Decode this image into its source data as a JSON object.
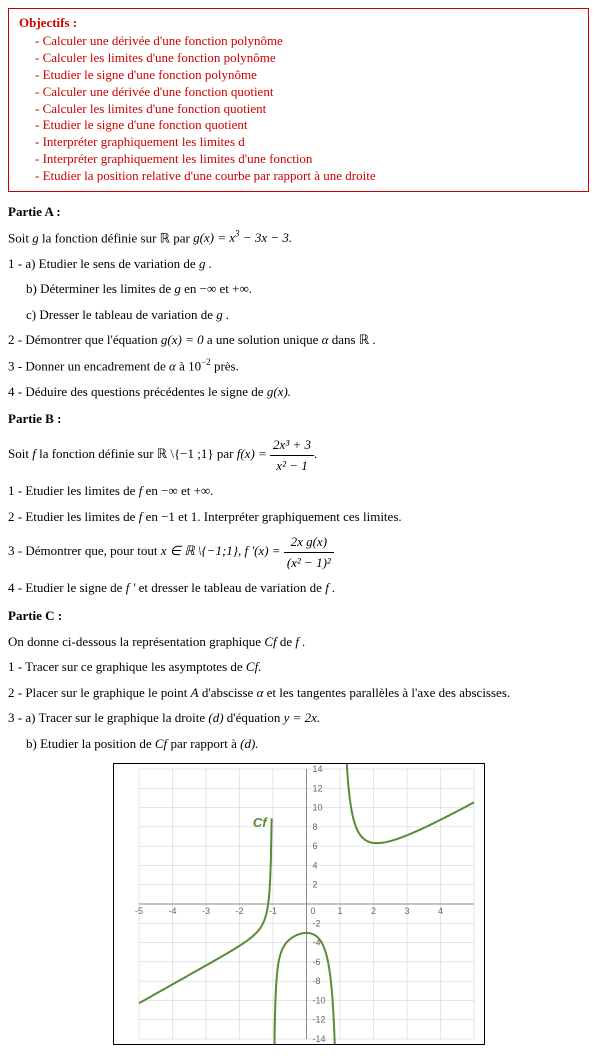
{
  "objectifs": {
    "title": "Objectifs :",
    "items": [
      "Calculer une dérivée d'une fonction polynôme",
      "Calculer les limites d'une fonction polynôme",
      "Etudier le signe d'une fonction polynôme",
      "Calculer une dérivée d'une fonction quotient",
      "Calculer les limites d'une fonction quotient",
      "Etudier le signe d'une fonction quotient",
      "Interpréter graphiquement les limites d",
      "Interpréter graphiquement les limites d'une fonction",
      "Etudier la position relative d'une courbe par rapport à une droite"
    ]
  },
  "partieA": {
    "title": "Partie A :",
    "intro_pre": "Soit ",
    "intro_g": "g",
    "intro_mid": " la fonction définie sur ",
    "intro_R": "ℝ",
    "intro_par": " par ",
    "intro_gx": "g(x) = x",
    "intro_exp": "3",
    "intro_rest": " − 3x − 3.",
    "q1a": "1 - a) Etudier le sens de variation de ",
    "q1a_g": "g .",
    "q1b": "b) Déterminer les limites de ",
    "q1b_g": "g",
    "q1b_en": " en −∞ et +∞.",
    "q1c": "c) Dresser le tableau de variation de ",
    "q1c_g": "g .",
    "q2": "2 - Démontrer que l'équation ",
    "q2_eq": "g(x) = 0",
    "q2_rest": " a une solution unique ",
    "q2_alpha": "α",
    "q2_dans": " dans ",
    "q2_R": "ℝ .",
    "q3": "3 - Donner un encadrement de ",
    "q3_alpha": "α",
    "q3_a": " à 10",
    "q3_exp": "−2",
    "q3_pres": " près.",
    "q4": "4 - Déduire des questions précédentes le signe de ",
    "q4_gx": "g(x)."
  },
  "partieB": {
    "title": "Partie B :",
    "intro_pre": "Soit ",
    "intro_f": "f",
    "intro_mid": " la fonction définie sur ",
    "intro_R": "ℝ \\{−1 ;1}",
    "intro_par": " par ",
    "intro_fx": "f(x) = ",
    "frac_num": "2x³ + 3",
    "frac_den": "x² − 1",
    "period": ".",
    "q1": "1 - Etudier les limites de ",
    "q1_f": "f",
    "q1_en": " en −∞ et +∞.",
    "q2": "2 - Etudier les limites de ",
    "q2_f": "f",
    "q2_en": " en −1 et 1. Interpréter graphiquement ces limites.",
    "q3": "3 - Démontrer que, pour tout ",
    "q3_x": "x ∈ ℝ \\{−1;1}, f '(x) = ",
    "q3_num": "2x g(x)",
    "q3_den": "(x² − 1)²",
    "q4": "4 - Etudier le signe de ",
    "q4_fp": "f '",
    "q4_rest": " et dresser le tableau de variation de ",
    "q4_f": "f ."
  },
  "partieC": {
    "title": "Partie C :",
    "intro": "On donne ci-dessous la représentation graphique ",
    "intro_cf": "Cf",
    "intro_de": " de ",
    "intro_f": "f .",
    "q1": "1 - Tracer sur ce graphique les asymptotes de ",
    "q1_cf": "Cf.",
    "q2": "2 - Placer sur le graphique le point ",
    "q2_A": "A",
    "q2_ab": " d'abscisse ",
    "q2_alpha": "α",
    "q2_rest": " et les tangentes parallèles à l'axe des abscisses.",
    "q3a": "3 - a) Tracer sur le graphique la droite ",
    "q3a_d": "(d)",
    "q3a_eq": " d'équation ",
    "q3a_y": "y = 2x.",
    "q3b": "b) Etudier la position de ",
    "q3b_cf": "Cf",
    "q3b_rest": " par rapport à ",
    "q3b_d": "(d)."
  },
  "chart_data": {
    "type": "line",
    "title": "",
    "xlabel": "",
    "ylabel": "",
    "xlim": [
      -5,
      5
    ],
    "ylim": [
      -14,
      14
    ],
    "xticks": [
      -5,
      -4,
      -3,
      -2,
      -1,
      0,
      1,
      2,
      3,
      4
    ],
    "yticks": [
      -14,
      -12,
      -10,
      -8,
      -6,
      -4,
      -2,
      2,
      4,
      6,
      8,
      10,
      12,
      14
    ],
    "asymptotes_vertical": [
      -1,
      1
    ],
    "curve_label": "Cf",
    "series": [
      {
        "name": "branch_left",
        "x": [
          -5,
          -4,
          -3,
          -2,
          -1.5,
          -1.2,
          -1.05
        ],
        "y": [
          -10.3,
          -8.33,
          -6.38,
          -4.33,
          -2.7,
          0.27,
          14
        ]
      },
      {
        "name": "branch_mid",
        "x": [
          -0.95,
          -0.8,
          -0.5,
          0,
          0.5,
          0.8,
          0.95
        ],
        "y": [
          -14,
          -5.49,
          -3.67,
          -3,
          -4.67,
          -11.22,
          -40
        ]
      },
      {
        "name": "branch_right",
        "x": [
          1.05,
          1.2,
          1.5,
          2,
          3,
          4,
          5
        ],
        "y": [
          50,
          14.73,
          7.8,
          6.33,
          7.13,
          8.73,
          10.54
        ]
      }
    ]
  }
}
